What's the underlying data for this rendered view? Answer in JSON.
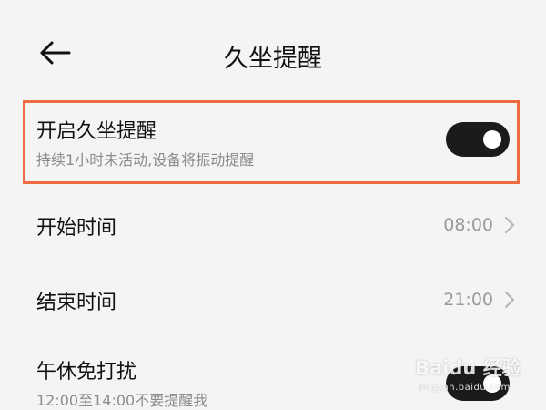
{
  "header": {
    "title": "久坐提醒",
    "back_icon": "arrow-left-icon"
  },
  "settings": {
    "reminder": {
      "label": "开启久坐提醒",
      "description": "持续1小时未活动,设备将振动提醒",
      "enabled": true
    },
    "start_time": {
      "label": "开始时间",
      "value": "08:00",
      "icon": "chevron-right-icon"
    },
    "end_time": {
      "label": "结束时间",
      "value": "21:00",
      "icon": "chevron-right-icon"
    },
    "nap_dnd": {
      "label": "午休免打扰",
      "description": "12:00至14:00不要提醒我",
      "enabled": true
    }
  },
  "colors": {
    "highlight": "#ec6b3f",
    "toggle_on": "#1b1b1b",
    "background": "#f4f4f4"
  },
  "watermark": {
    "logo_text": "Baidu 经验",
    "url": "jingyan.baidu.com"
  }
}
